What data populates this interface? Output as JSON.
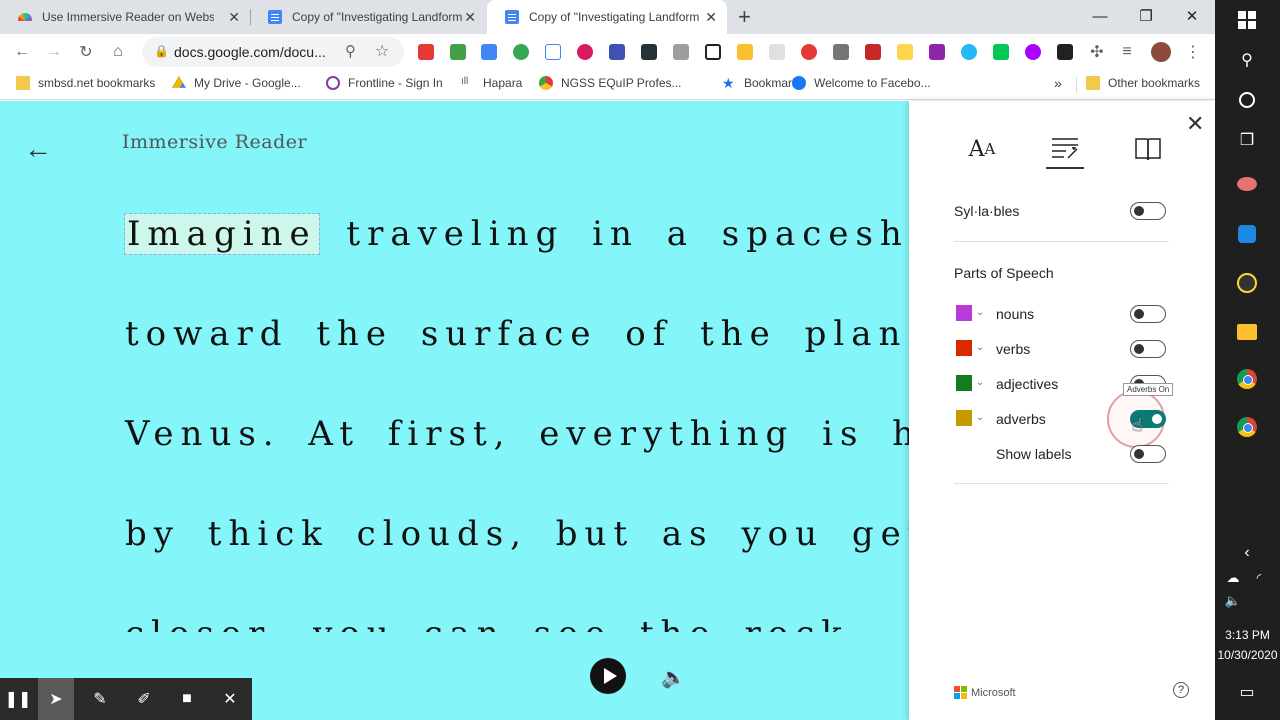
{
  "browser": {
    "tabs": [
      {
        "title": "Use Immersive Reader on Websit",
        "active": false
      },
      {
        "title": "Copy of \"Investigating Landform",
        "active": false
      },
      {
        "title": "Copy of \"Investigating Landform",
        "active": true
      }
    ],
    "new_tab_label": "+",
    "url": "docs.google.com/docu...",
    "bookmarks": [
      "smbsd.net bookmarks",
      "My Drive - Google...",
      "Frontline - Sign In",
      "Hapara",
      "NGSS EQuIP Profes...",
      "Bookmarks",
      "Welcome to Facebo..."
    ],
    "overflow_label": "»",
    "other_bookmarks": "Other bookmarks"
  },
  "reader": {
    "title": "Immersive Reader",
    "highlighted_word": "Imagine",
    "lines": [
      " traveling in a spaceship",
      "toward the surface of the planet",
      "Venus. At first, everything is hidden",
      "by thick clouds, but as you get",
      "closer, you can see the rock"
    ]
  },
  "panel": {
    "syllables_label": "Syl·la·bles",
    "parts_of_speech_heading": "Parts of Speech",
    "parts": [
      {
        "label": "nouns",
        "color": "#b83ad8",
        "on": false
      },
      {
        "label": "verbs",
        "color": "#d62b00",
        "on": false
      },
      {
        "label": "adjectives",
        "color": "#117d1e",
        "on": false
      },
      {
        "label": "adverbs",
        "color": "#c49a00",
        "on": true
      }
    ],
    "show_labels": "Show labels",
    "tooltip": "Adverbs On",
    "brand": "Microsoft",
    "help": "?"
  },
  "taskbar": {
    "time": "3:13 PM",
    "date": "10/30/2020"
  },
  "colors": {
    "reader_bg": "#84f5f9",
    "toggle_on": "#0a7a73"
  }
}
